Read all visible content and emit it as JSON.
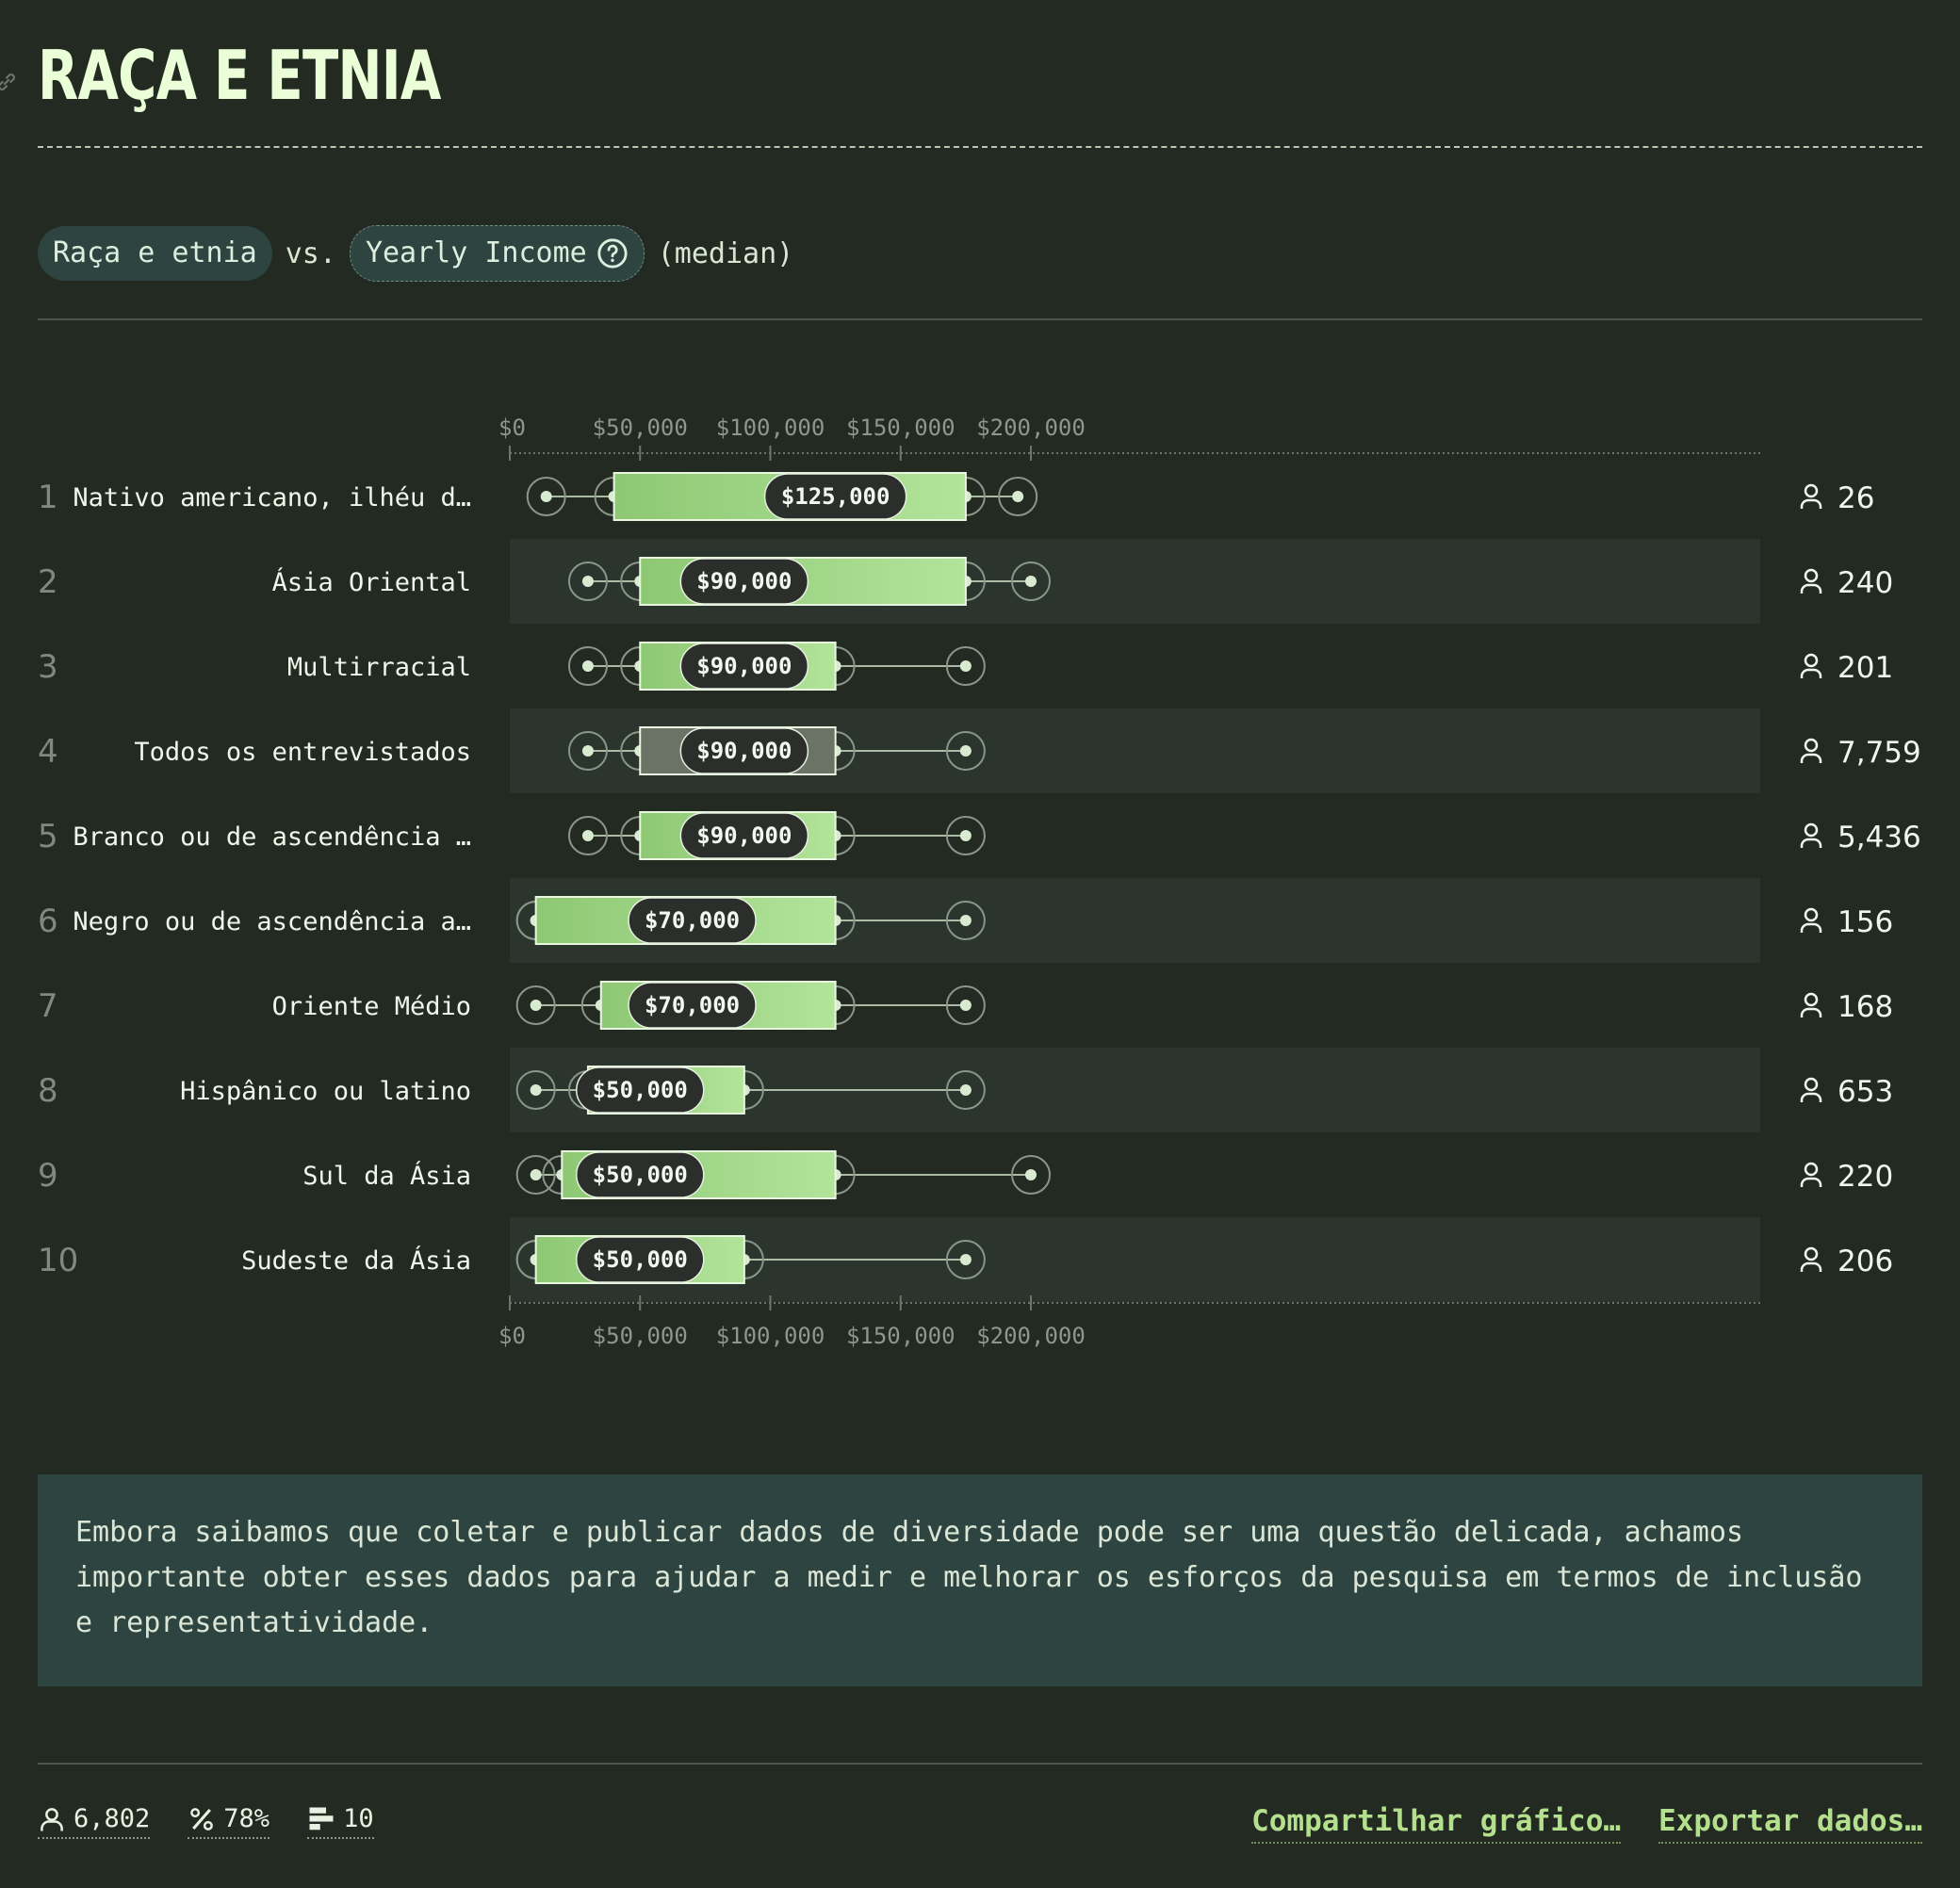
{
  "header": {
    "title": "RAÇA E ETNIA",
    "icon": "link-icon"
  },
  "controls": {
    "group_label": "Raça e etnia",
    "vs_label": "vs.",
    "variable_label": "Yearly Income",
    "stat_label": "(median)"
  },
  "chart_data": {
    "type": "boxplot",
    "x_tick_labels": [
      "$0",
      "$50,000",
      "$100,000",
      "$150,000",
      "$200,000"
    ],
    "x_ticks": [
      0,
      50000,
      100000,
      150000,
      200000
    ],
    "xlim": [
      0,
      240000
    ],
    "categories": [
      "Nativo americano, ilhéu d…",
      "Ásia Oriental",
      "Multirracial",
      "Todos os entrevistados",
      "Branco ou de ascendência …",
      "Negro ou de ascendência a…",
      "Oriente Médio",
      "Hispânico ou latino",
      "Sul da Ásia",
      "Sudeste da Ásia"
    ],
    "ranks": [
      "1",
      "2",
      "3",
      "4",
      "5",
      "6",
      "7",
      "8",
      "9",
      "10"
    ],
    "rows": [
      {
        "p10": 14000,
        "q1": 40000,
        "median": 125000,
        "median_label": "$125,000",
        "q3": 175000,
        "p90": 195000,
        "count": "26"
      },
      {
        "p10": 30000,
        "q1": 50000,
        "median": 90000,
        "median_label": "$90,000",
        "q3": 175000,
        "p90": 200000,
        "count": "240"
      },
      {
        "p10": 30000,
        "q1": 50000,
        "median": 90000,
        "median_label": "$90,000",
        "q3": 125000,
        "p90": 175000,
        "count": "201"
      },
      {
        "p10": 30000,
        "q1": 50000,
        "median": 90000,
        "median_label": "$90,000",
        "q3": 125000,
        "p90": 175000,
        "count": "7,759",
        "highlight": true
      },
      {
        "p10": 30000,
        "q1": 50000,
        "median": 90000,
        "median_label": "$90,000",
        "q3": 125000,
        "p90": 175000,
        "count": "5,436"
      },
      {
        "p10": 10000,
        "q1": 10000,
        "median": 70000,
        "median_label": "$70,000",
        "q3": 125000,
        "p90": 175000,
        "count": "156"
      },
      {
        "p10": 10000,
        "q1": 35000,
        "median": 70000,
        "median_label": "$70,000",
        "q3": 125000,
        "p90": 175000,
        "count": "168"
      },
      {
        "p10": 10000,
        "q1": 30000,
        "median": 50000,
        "median_label": "$50,000",
        "q3": 90000,
        "p90": 175000,
        "count": "653"
      },
      {
        "p10": 10000,
        "q1": 20000,
        "median": 50000,
        "median_label": "$50,000",
        "q3": 125000,
        "p90": 200000,
        "count": "220"
      },
      {
        "p10": 10000,
        "q1": 10000,
        "median": 50000,
        "median_label": "$50,000",
        "q3": 90000,
        "p90": 175000,
        "count": "206"
      }
    ],
    "colors": {
      "box_start": "#8ec874",
      "box_end": "#b2e49a",
      "highlight_box": "#6a7366",
      "median_pill": "#2b2e2a",
      "band": "#2b342d",
      "whisker": "#d8ead0"
    }
  },
  "note": {
    "text": "Embora saibamos que coletar e publicar dados de diversidade pode ser uma questão delicada, achamos importante obter esses dados para ajudar a medir e melhorar os esforços da pesquisa em termos de inclusão e representatividade."
  },
  "footer": {
    "respondents": "6,802",
    "percent": "78%",
    "groups": "10",
    "share_label": "Compartilhar gráfico…",
    "export_label": "Exportar dados…"
  }
}
